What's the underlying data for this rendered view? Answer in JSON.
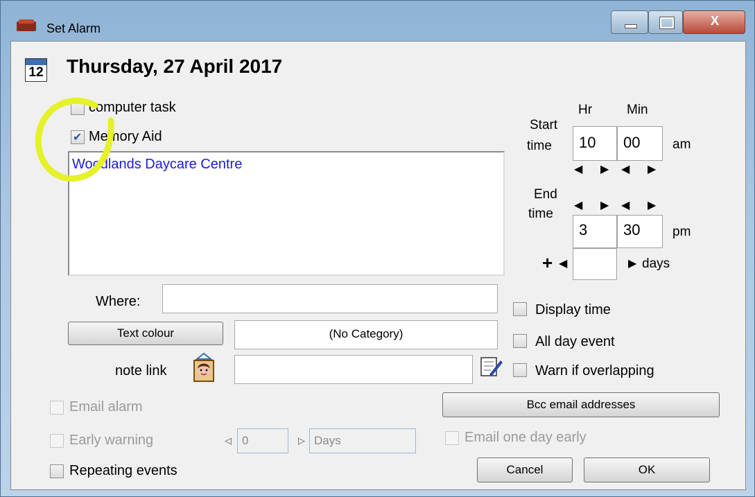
{
  "window": {
    "title": "Set Alarm",
    "close_glyph": "X"
  },
  "calendar_icon_number": "12",
  "date_heading": "Thursday, 27 April 2017",
  "checkboxes": {
    "computer_task": {
      "label": "computer task",
      "checked": false
    },
    "memory_aid": {
      "label": "Memory Aid",
      "checked": true
    },
    "display_time": {
      "label": "Display time",
      "checked": false
    },
    "all_day_event": {
      "label": "All day event",
      "checked": false
    },
    "warn_overlapping": {
      "label": "Warn if overlapping",
      "checked": false
    },
    "email_alarm": {
      "label": "Email alarm",
      "checked": false
    },
    "early_warning": {
      "label": "Early warning",
      "checked": false
    },
    "email_one_day_early": {
      "label": "Email one day early",
      "checked": false
    },
    "repeating_events": {
      "label": "Repeating events",
      "checked": false
    }
  },
  "memo_text": "Woodlands Daycare Centre",
  "time": {
    "hr_label": "Hr",
    "min_label": "Min",
    "start_label_1": "Start",
    "start_label_2": "time",
    "start_hr": "10",
    "start_min": "00",
    "start_ampm": "am",
    "end_label_1": "End",
    "end_label_2": "time",
    "end_hr": "3",
    "end_min": "30",
    "end_ampm": "pm",
    "plus": "+",
    "days_value": "",
    "days_label": "days"
  },
  "where_label": "Where:",
  "where_value": "",
  "text_colour_button": "Text colour",
  "category_value": "(No Category)",
  "note_link_label": "note link",
  "note_link_value": "",
  "bcc_button": "Bcc email addresses",
  "early_warning_value": "0",
  "early_warning_unit": "Days",
  "cancel_button": "Cancel",
  "ok_button": "OK",
  "colors": {
    "highlight": "#e6f12a",
    "memo_text": "#1a1adc"
  }
}
